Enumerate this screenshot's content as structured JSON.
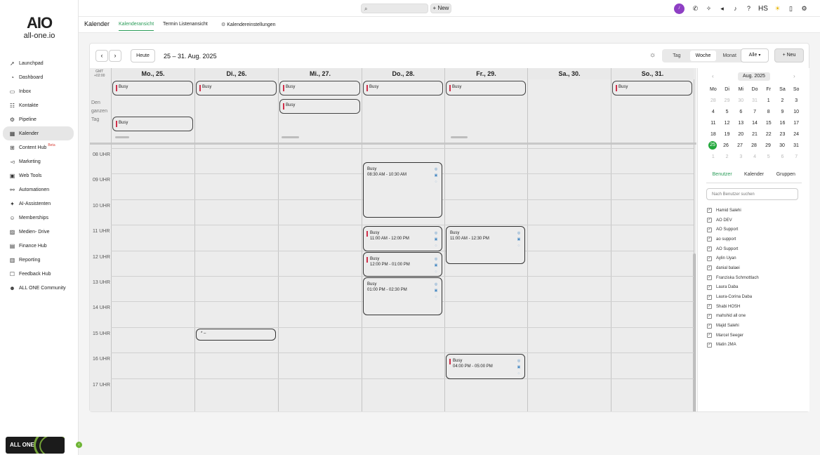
{
  "app": {
    "logo_mark": "AIO",
    "logo_text": "all-one.io"
  },
  "sidebar": {
    "items": [
      {
        "label": "Launchpad",
        "icon": "rocket-icon",
        "glyph": "➚"
      },
      {
        "label": "Dashboard",
        "icon": "gauge-icon",
        "glyph": "◔"
      },
      {
        "label": "Inbox",
        "icon": "chat-icon",
        "glyph": "▭"
      },
      {
        "label": "Kontakte",
        "icon": "contacts-icon",
        "glyph": "☷"
      },
      {
        "label": "Pipeline",
        "icon": "pipeline-icon",
        "glyph": "⚙"
      },
      {
        "label": "Kalender",
        "icon": "calendar-icon",
        "glyph": "▦"
      },
      {
        "label": "Content Hub",
        "icon": "content-icon",
        "glyph": "⊞",
        "badge": "Beta"
      },
      {
        "label": "Marketing",
        "icon": "megaphone-icon",
        "glyph": "◅"
      },
      {
        "label": "Web Tools",
        "icon": "web-icon",
        "glyph": "▣"
      },
      {
        "label": "Automationen",
        "icon": "automation-icon",
        "glyph": "⚯"
      },
      {
        "label": "AI-Assistenten",
        "icon": "sparkle-icon",
        "glyph": "✦"
      },
      {
        "label": "Memberships",
        "icon": "members-icon",
        "glyph": "☺"
      },
      {
        "label": "Medien- Drive",
        "icon": "image-icon",
        "glyph": "▨"
      },
      {
        "label": "Finance Hub",
        "icon": "finance-icon",
        "glyph": "▤"
      },
      {
        "label": "Reporting",
        "icon": "report-icon",
        "glyph": "▥"
      },
      {
        "label": "Feedback Hub",
        "icon": "feedback-icon",
        "glyph": "☐"
      },
      {
        "label": "ALL ONE Community",
        "icon": "community-icon",
        "glyph": "☻"
      }
    ],
    "bottom_label": "ALL ONE"
  },
  "topbar": {
    "new_label": "+ New",
    "avatar_initials": "ﾉ",
    "user_initials": "HS"
  },
  "subheader": {
    "title": "Kalender",
    "tabs": [
      "Kalenderansicht",
      "Termin Listenansicht",
      "Kalendereinstellungen"
    ]
  },
  "toolbar": {
    "today": "Heute",
    "range": "25 – 31. Aug. 2025",
    "views": [
      "Tag",
      "Woche",
      "Monat"
    ],
    "active_view": "Woche",
    "filter": "Alle",
    "new_label": "+ Neu"
  },
  "calendar": {
    "gmt": "GMT\n+02:00",
    "allday_label": "Den\nganzen\nTag",
    "days": [
      "Mo., 25.",
      "Di., 26.",
      "Mi., 27.",
      "Do., 28.",
      "Fr., 29.",
      "Sa., 30.",
      "So., 31."
    ],
    "hours": [
      "08 UHR",
      "09 UHR",
      "10 UHR",
      "11 UHR",
      "12 UHR",
      "13 UHR",
      "14 UHR",
      "15 UHR",
      "16 UHR",
      "17 UHR"
    ],
    "allday_events": [
      {
        "day": 0,
        "row": 0,
        "title": "Busy"
      },
      {
        "day": 1,
        "row": 0,
        "title": "Busy"
      },
      {
        "day": 2,
        "row": 0,
        "title": "Busy"
      },
      {
        "day": 3,
        "row": 0,
        "title": "Busy"
      },
      {
        "day": 4,
        "row": 0,
        "title": "Busy"
      },
      {
        "day": 6,
        "row": 0,
        "title": "Busy"
      },
      {
        "day": 2,
        "row": 1,
        "title": "Busy"
      },
      {
        "day": 0,
        "row": 2,
        "title": "Busy"
      }
    ],
    "events": [
      {
        "day": 3,
        "title": "Busy",
        "time": "08:30 AM - 10:30 AM",
        "start": 8.5,
        "end": 10.7,
        "bar": false
      },
      {
        "day": 3,
        "title": "Busy",
        "time": "11:00 AM - 12:00 PM",
        "start": 11,
        "end": 12,
        "bar": true
      },
      {
        "day": 4,
        "title": "Busy",
        "time": "11:00 AM - 12:30 PM",
        "start": 11,
        "end": 12.5,
        "bar": false
      },
      {
        "day": 3,
        "title": "Busy",
        "time": "12:00 PM - 01:00 PM",
        "start": 12,
        "end": 13,
        "bar": true
      },
      {
        "day": 3,
        "title": "Busy",
        "time": "01:00 PM - 02:30 PM",
        "start": 13,
        "end": 14.5,
        "bar": false
      },
      {
        "day": 1,
        "title": "* –",
        "time": "",
        "start": 15,
        "end": 15.5,
        "bar": false
      },
      {
        "day": 4,
        "title": "Busy",
        "time": "04:00 PM - 05:00 PM",
        "start": 16,
        "end": 17,
        "bar": true
      }
    ]
  },
  "mini_calendar": {
    "month": "Aug. 2025",
    "weekdays": [
      "Mo",
      "Di",
      "Mi",
      "Do",
      "Fr",
      "Sa",
      "So"
    ],
    "weeks": [
      [
        "28",
        "29",
        "30",
        "31",
        "1",
        "2",
        "3"
      ],
      [
        "4",
        "5",
        "6",
        "7",
        "8",
        "9",
        "10"
      ],
      [
        "11",
        "12",
        "13",
        "14",
        "15",
        "16",
        "17"
      ],
      [
        "18",
        "19",
        "20",
        "21",
        "22",
        "23",
        "24"
      ],
      [
        "25",
        "26",
        "27",
        "28",
        "29",
        "30",
        "31"
      ],
      [
        "1",
        "2",
        "3",
        "4",
        "5",
        "6",
        "7"
      ]
    ],
    "today": "25"
  },
  "panel": {
    "tabs": [
      "Benutzer",
      "Kalender",
      "Gruppen"
    ],
    "search_placeholder": "Nach Benutzer suchen",
    "users": [
      "Hamid Salehi",
      "AO DEV",
      "AO Support",
      "ao support",
      "AO Support",
      "Aylin Uyan",
      "danial balaei",
      "Franziska Schmottlach",
      "Laura Daba",
      "Laura-Corina Daba",
      "Shabi HOSH",
      "mahshid all one",
      "Majid Salehi",
      "Marcel Seeger",
      "Matin 2MA"
    ]
  }
}
